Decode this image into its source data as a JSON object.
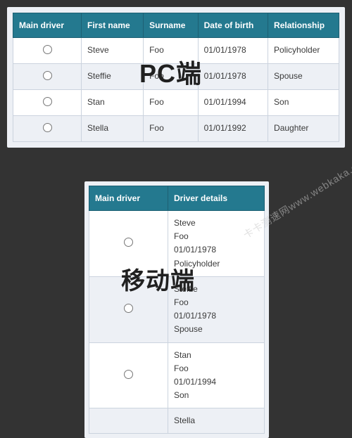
{
  "labels": {
    "pc": "PC端",
    "mobile": "移动端"
  },
  "watermark": "卡卡测速网www.webkaka.com",
  "pc_table": {
    "headers": [
      "Main driver",
      "First name",
      "Surname",
      "Date of birth",
      "Relationship"
    ],
    "rows": [
      {
        "first": "Steve",
        "surname": "Foo",
        "dob": "01/01/1978",
        "rel": "Policyholder"
      },
      {
        "first": "Steffie",
        "surname": "Foo",
        "dob": "01/01/1978",
        "rel": "Spouse"
      },
      {
        "first": "Stan",
        "surname": "Foo",
        "dob": "01/01/1994",
        "rel": "Son"
      },
      {
        "first": "Stella",
        "surname": "Foo",
        "dob": "01/01/1992",
        "rel": "Daughter"
      }
    ]
  },
  "mobile_table": {
    "headers": [
      "Main driver",
      "Driver details"
    ],
    "rows": [
      {
        "lines": [
          "Steve",
          "Foo",
          "01/01/1978",
          "Policyholder"
        ]
      },
      {
        "lines": [
          "Steffie",
          "Foo",
          "01/01/1978",
          "Spouse"
        ]
      },
      {
        "lines": [
          "Stan",
          "Foo",
          "01/01/1994",
          "Son"
        ]
      },
      {
        "lines": [
          "Stella"
        ]
      }
    ]
  }
}
